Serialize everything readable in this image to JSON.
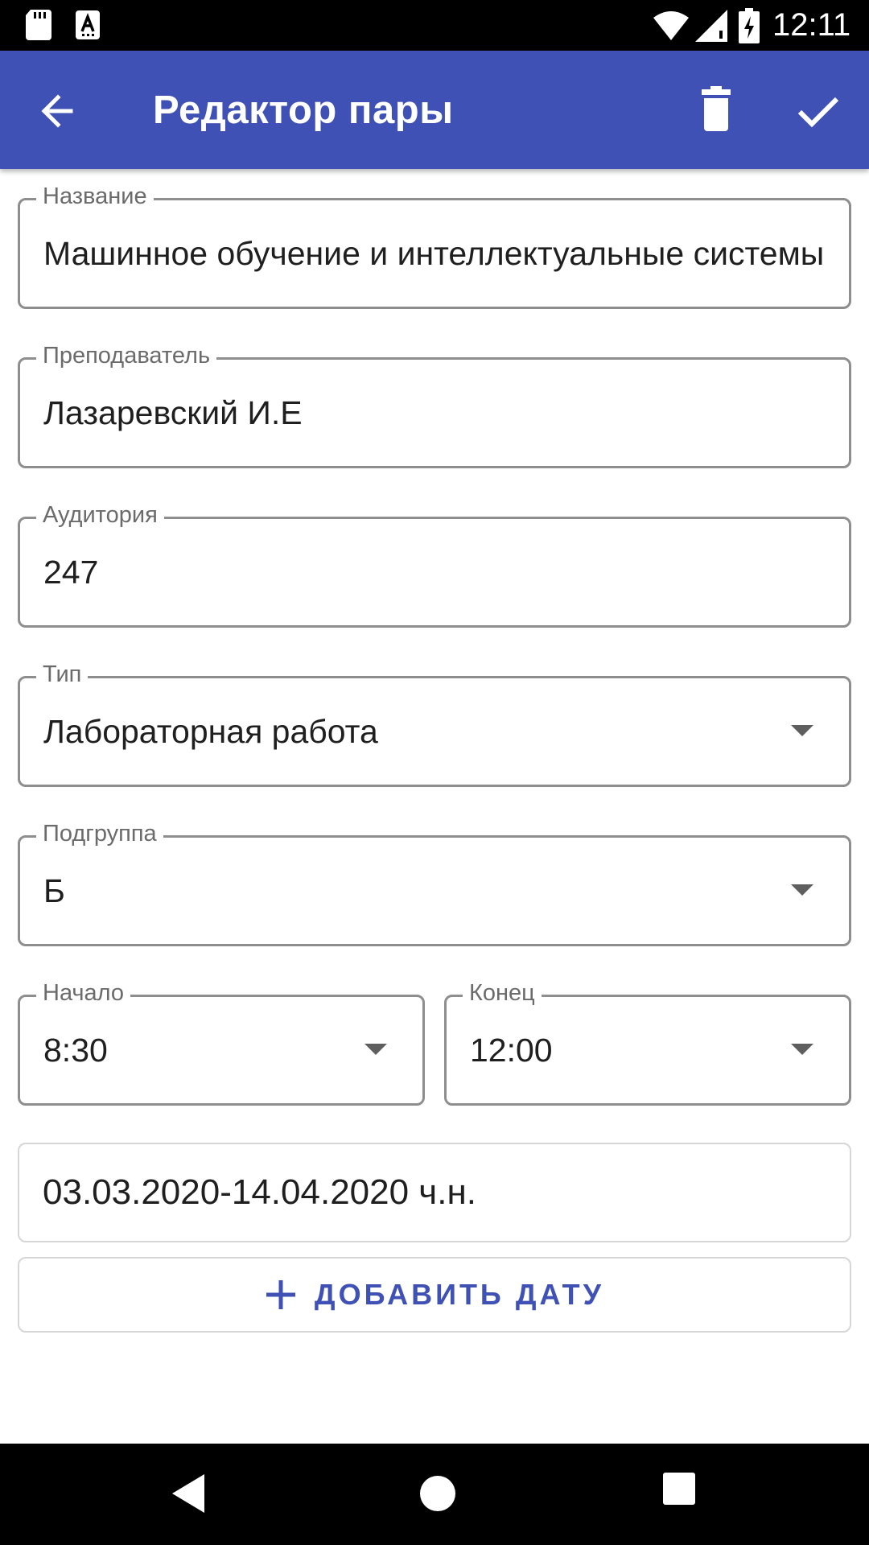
{
  "status_bar": {
    "time": "12:11",
    "icons": [
      "sd-card-icon",
      "a-notification-icon",
      "wifi-icon",
      "cell-signal-icon",
      "battery-charging-icon"
    ]
  },
  "app_bar": {
    "title": "Редактор пары",
    "color": "#3f51b5",
    "icons": [
      "back-arrow-icon",
      "trash-icon",
      "checkmark-icon"
    ]
  },
  "form": {
    "name": {
      "label": "Название",
      "value": "Машинное обучение и интеллектуальные системы"
    },
    "teacher": {
      "label": "Преподаватель",
      "value": "Лазаревский И.Е"
    },
    "room": {
      "label": "Аудитория",
      "value": "247"
    },
    "type": {
      "label": "Тип",
      "value": "Лабораторная работа"
    },
    "subgroup": {
      "label": "Подгруппа",
      "value": "Б"
    },
    "start": {
      "label": "Начало",
      "value": "8:30"
    },
    "end": {
      "label": "Конец",
      "value": "12:00"
    }
  },
  "dates": [
    {
      "text": "03.03.2020-14.04.2020 ч.н."
    }
  ],
  "add_date": {
    "label": "ДОБАВИТЬ ДАТУ",
    "icon": "plus-icon"
  },
  "nav_bar": {
    "icons": [
      "nav-back-icon",
      "nav-home-icon",
      "nav-recents-icon"
    ]
  }
}
